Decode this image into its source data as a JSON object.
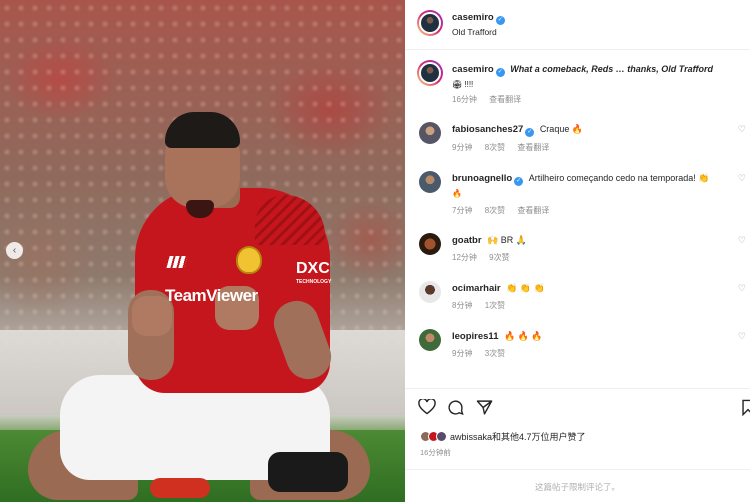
{
  "header": {
    "username": "casemiro",
    "location": "Old Trafford"
  },
  "photo": {
    "sponsor_text": "TeamViewer",
    "dxc_text": "DXC",
    "dxc_sub": "TECHNOLOGY",
    "prev_button": "‹"
  },
  "caption": {
    "username": "casemiro",
    "text": "What a comeback, Reds … thanks, Old Trafford",
    "text2": "🏟 !!!!",
    "time": "16分钟",
    "translate": "查看翻译"
  },
  "comments": [
    {
      "username": "fabiosanches27",
      "verified": true,
      "text": "Craque 🔥",
      "time": "9分钟",
      "likes": "8次赞",
      "translate": "查看翻译"
    },
    {
      "username": "brunoagnello",
      "verified": true,
      "text": "Artilheiro começando cedo na temporada! 👏",
      "text2": "🔥",
      "time": "7分钟",
      "likes": "8次赞",
      "translate": "查看翻译"
    },
    {
      "username": "goatbr",
      "verified": false,
      "text": "🙌 BR 🙏",
      "time": "12分钟",
      "likes": "9次赞"
    },
    {
      "username": "ocimarhair",
      "verified": false,
      "text": "👏 👏 👏",
      "time": "8分钟",
      "likes": "1次赞"
    },
    {
      "username": "leopires11",
      "verified": false,
      "text": "🔥 🔥 🔥",
      "time": "9分钟",
      "likes": "3次赞"
    }
  ],
  "actions": {
    "likes_text": "awbissaka和其他4.7万位用户赞了",
    "post_time": "16分钟前",
    "comments_disabled": "这篇帖子限制评论了。"
  },
  "colors": {
    "verified": "#3897f0",
    "secondary_text": "#8e8e8e",
    "kit_red": "#c4161c"
  }
}
